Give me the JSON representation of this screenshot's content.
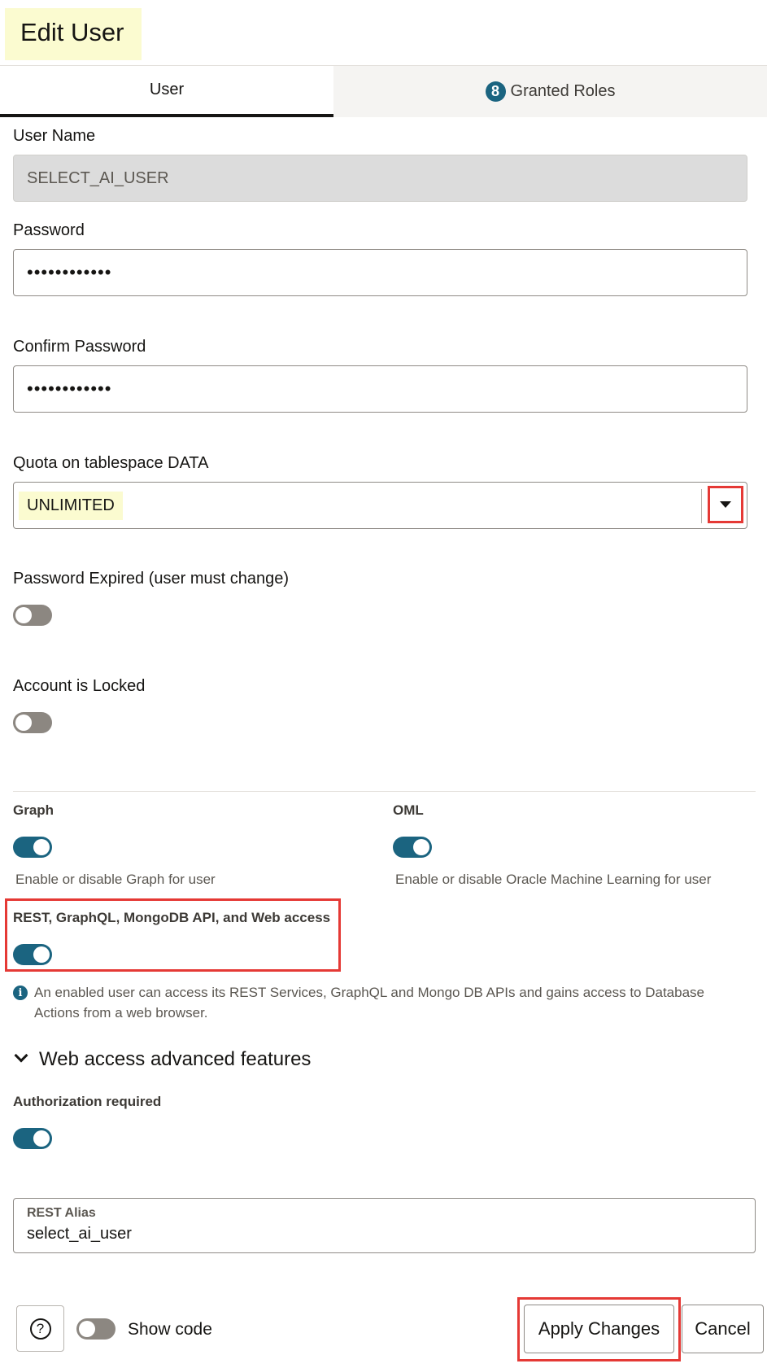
{
  "page": {
    "title": "Edit User"
  },
  "tabs": {
    "user": "User",
    "roles_count": "8",
    "roles": "Granted Roles"
  },
  "form": {
    "user_name_label": "User Name",
    "user_name_value": "SELECT_AI_USER",
    "password_label": "Password",
    "password_value": "••••••••••••",
    "confirm_label": "Confirm Password",
    "confirm_value": "••••••••••••",
    "quota_label": "Quota on tablespace DATA",
    "quota_value": "UNLIMITED",
    "expired_label": "Password Expired (user must change)",
    "expired_on": false,
    "locked_label": "Account is Locked",
    "locked_on": false
  },
  "features": {
    "graph_label": "Graph",
    "graph_on": true,
    "graph_help": "Enable or disable Graph for user",
    "oml_label": "OML",
    "oml_on": true,
    "oml_help": "Enable or disable Oracle Machine Learning for user",
    "rest_label": "REST, GraphQL, MongoDB API, and Web access",
    "rest_on": true,
    "rest_info_line1": "An enabled user can access its REST Services, GraphQL and Mongo DB APIs and gains access to Database",
    "rest_info_line2": "Actions from a web browser."
  },
  "advanced": {
    "section_title": "Web access advanced features",
    "auth_label": "Authorization required",
    "auth_on": true,
    "alias_label": "REST Alias",
    "alias_value": "select_ai_user"
  },
  "footer": {
    "help_glyph": "?",
    "show_code_label": "Show code",
    "show_code_on": false,
    "apply_label": "Apply Changes",
    "cancel_label": "Cancel"
  },
  "colors": {
    "accent": "#1b6480",
    "highlight": "#fbfbd0",
    "annotation_red": "#e53935"
  }
}
